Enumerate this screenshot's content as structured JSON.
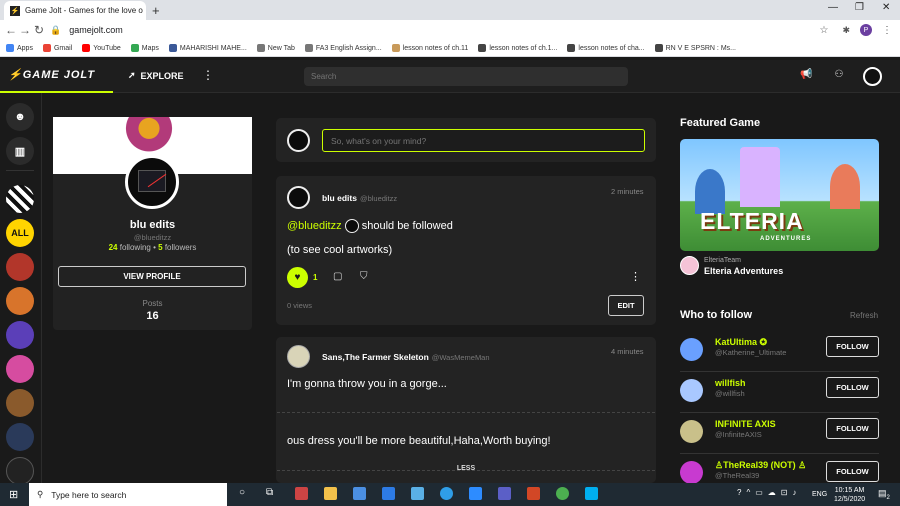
{
  "browser": {
    "tab_title": "Game Jolt - Games for the love o",
    "url": "gamejolt.com",
    "bookmarks": [
      {
        "label": "Apps",
        "color": "#4285f4"
      },
      {
        "label": "Gmail",
        "color": "#ea4335"
      },
      {
        "label": "YouTube",
        "color": "#ff0000"
      },
      {
        "label": "Maps",
        "color": "#34a853"
      },
      {
        "label": "MAHARISHI MAHE...",
        "color": "#3b5998"
      },
      {
        "label": "New Tab",
        "color": "#777777"
      },
      {
        "label": "FA3 English Assign...",
        "color": "#777777"
      },
      {
        "label": "lesson notes of ch.11",
        "color": "#c89a5a"
      },
      {
        "label": "lesson notes of ch.1...",
        "color": "#444444"
      },
      {
        "label": "lesson notes of cha...",
        "color": "#444444"
      },
      {
        "label": "RN V E SPSRN : Ms...",
        "color": "#444444"
      }
    ]
  },
  "header": {
    "logo": "GAME JOLT",
    "explore": "EXPLORE",
    "search_placeholder": "Search"
  },
  "rail": {
    "all_label": "ALL"
  },
  "profile": {
    "name": "blu edits",
    "handle": "@blueditzz",
    "following_count": "24",
    "following_label": "following",
    "followers_count": "5",
    "followers_label": "followers",
    "view_profile": "VIEW PROFILE",
    "posts_label": "Posts",
    "posts_count": "16"
  },
  "composer": {
    "placeholder": "So, what's on your mind?"
  },
  "post1": {
    "author": "blu edits",
    "handle": "@blueditzz",
    "time": "2 minutes",
    "mention": "@blueditzz",
    "line1_rest": "should be followed",
    "line2": "(to see cool artworks)",
    "likes": "1",
    "views": "0 views",
    "edit": "EDIT"
  },
  "post2": {
    "author": "Sans,The Farmer Skeleton",
    "handle": "@WasMemeMan",
    "time": "4 minutes",
    "line1": "I'm gonna throw you in a gorge...",
    "line2": "ous dress you'll be more beautiful,Haha,Worth buying!",
    "less": "LESS"
  },
  "featured": {
    "title": "Featured Game",
    "logo": "ELTERIA",
    "logo_sub": "ADVENTURES",
    "team": "ElteriaTeam",
    "game": "Elteria Adventures"
  },
  "who_to_follow": {
    "title": "Who to follow",
    "refresh": "Refresh",
    "users": [
      {
        "name": "KatUltima",
        "verified": true,
        "handle": "@Katherine_Ultimate",
        "button": "FOLLOW",
        "color": "#6aa0ff"
      },
      {
        "name": "willfish",
        "handle": "@willfish",
        "button": "FOLLOW",
        "color": "#a9c8ff"
      },
      {
        "name": "INFINITE AXIS",
        "handle": "@InfiniteAXIS",
        "button": "FOLLOW",
        "color": "#c9c08a"
      },
      {
        "name": "♙TheReal39 (NOT) ♙",
        "handle": "@TheReal39",
        "button": "FOLLOW",
        "color": "#c83ad0"
      }
    ]
  },
  "taskbar": {
    "search_placeholder": "Type here to search",
    "lang": "ENG",
    "time": "10:15 AM",
    "date": "12/5/2020",
    "notifications": "2"
  }
}
